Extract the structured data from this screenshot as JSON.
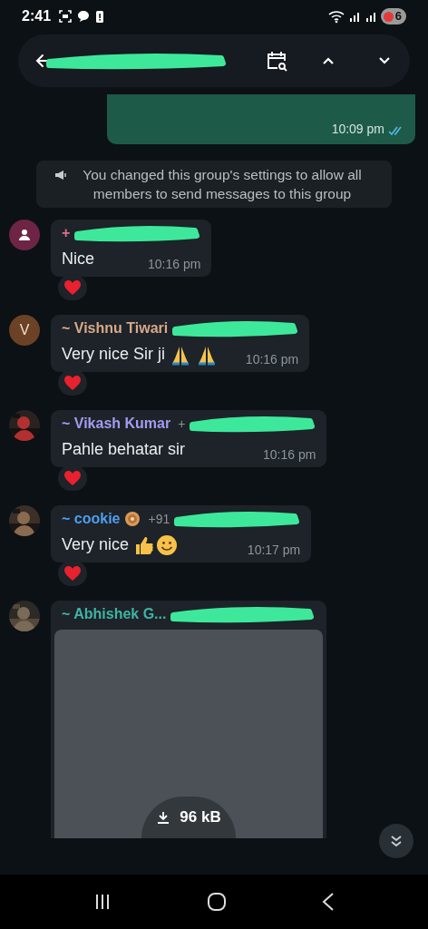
{
  "status_bar": {
    "time": "2:41",
    "battery": "6"
  },
  "header": {
    "redacted_title": true
  },
  "outgoing": {
    "time": "10:09 pm",
    "read": true
  },
  "system_message": "You changed this group's settings to allow all members to send messages to this group",
  "messages": [
    {
      "kind": "text",
      "avatar": {
        "kind": "icon",
        "color": "#6e2545"
      },
      "sender": "+",
      "color": "#e06c8c",
      "redacted_phone": true,
      "text": "Nice",
      "time": "10:16 pm",
      "reacted": true
    },
    {
      "kind": "text",
      "avatar": {
        "kind": "letter",
        "letter": "V",
        "color": "#6b4226"
      },
      "sender": "~ Vishnu Tiwari",
      "color": "#d8a88a",
      "redacted_phone": true,
      "text": "Very nice Sir ji",
      "trailing_icons": [
        {
          "kind": "hands"
        },
        {
          "kind": "hands"
        }
      ],
      "time": "10:16 pm",
      "reacted": true
    },
    {
      "kind": "text",
      "sender": "~ Vikash Kumar",
      "color": "#a59af2",
      "phone": "+",
      "redacted_phone": true,
      "text": "Pahle behatar sir",
      "time": "10:16 pm",
      "reacted": true
    },
    {
      "kind": "text",
      "sender": "~ cookie",
      "name_icon": {
        "kind": "cookie"
      },
      "color": "#4f9ef0",
      "phone": "+91",
      "redacted_phone": true,
      "text": "Very nice",
      "trailing_icons": [
        {
          "kind": "thumb"
        },
        {
          "kind": "smile"
        }
      ],
      "time": "10:17 pm",
      "reacted": true
    },
    {
      "sender": "~ Abhishek G...",
      "color": "#3fb3a6",
      "redacted_phone": true,
      "size": "96 kB"
    }
  ]
}
